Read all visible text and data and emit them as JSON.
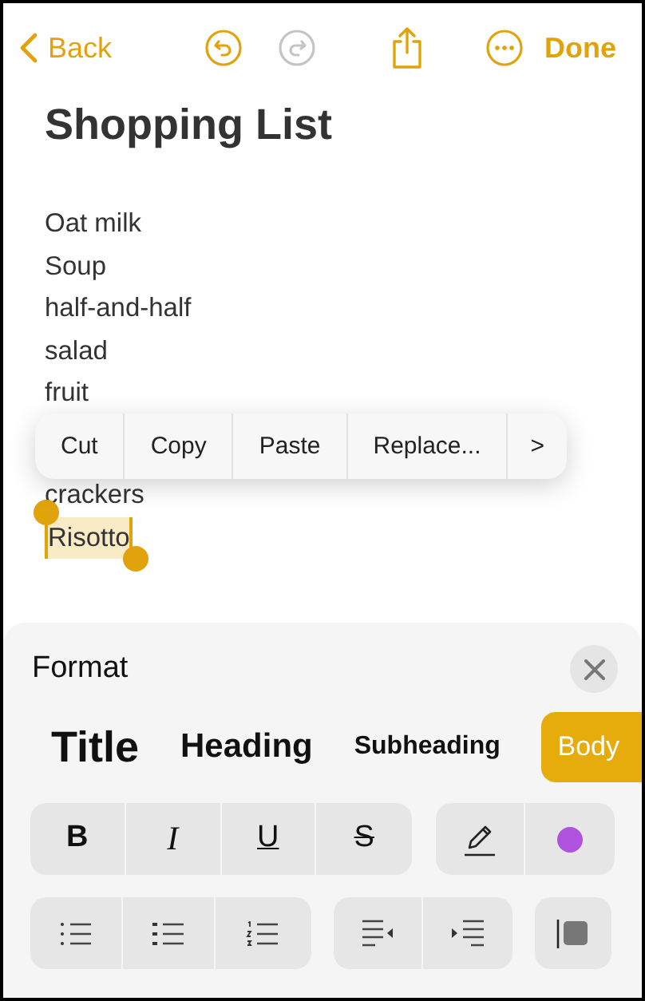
{
  "nav": {
    "back": "Back",
    "undo": {
      "disabled": false
    },
    "redo": {
      "disabled": true
    },
    "done": "Done"
  },
  "note": {
    "title": "Shopping List",
    "lines": [
      {
        "text": "Oat milk",
        "selected": false
      },
      {
        "text": "Soup",
        "selected": false
      },
      {
        "text": "half-and-half",
        "selected": false
      },
      {
        "text": "salad",
        "selected": false
      },
      {
        "text": "fruit",
        "selected": false
      },
      {
        "text": "crackers",
        "selected": false
      },
      {
        "text": "Risotto",
        "selected": true
      }
    ]
  },
  "edit_menu": {
    "items": [
      "Cut",
      "Copy",
      "Paste",
      "Replace..."
    ],
    "more": ">"
  },
  "format": {
    "title": "Format",
    "styles": [
      {
        "label": "Title",
        "kind": "title",
        "selected": false
      },
      {
        "label": "Heading",
        "kind": "heading",
        "selected": false
      },
      {
        "label": "Subheading",
        "kind": "subheading",
        "selected": false
      },
      {
        "label": "Body",
        "kind": "body",
        "selected": true
      }
    ],
    "text_buttons": [
      {
        "label": "B",
        "kind": "bold"
      },
      {
        "label": "I",
        "kind": "italic"
      },
      {
        "label": "U",
        "kind": "underline"
      },
      {
        "label": "S",
        "kind": "strike"
      }
    ],
    "text_color": {
      "color": "#af52de"
    }
  }
}
